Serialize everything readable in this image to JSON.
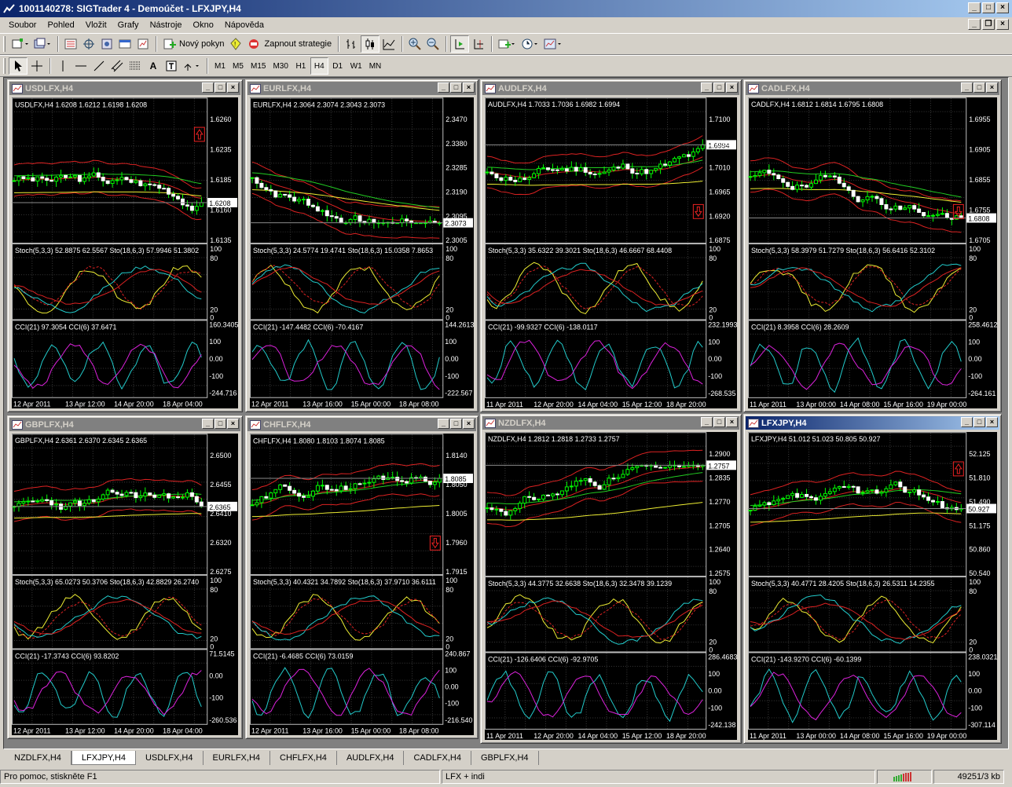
{
  "window": {
    "title": "1001140278: SIGTrader 4 - Demoúčet - LFXJPY,H4"
  },
  "menu": [
    "Soubor",
    "Pohled",
    "Vložit",
    "Grafy",
    "Nástroje",
    "Okno",
    "Nápověda"
  ],
  "toolbar": {
    "new_order": "Nový pokyn",
    "strategies": "Zapnout strategie",
    "timeframes": [
      "M1",
      "M5",
      "M15",
      "M30",
      "H1",
      "H4",
      "D1",
      "W1",
      "MN"
    ],
    "active_timeframe": "H4",
    "text_tool": "A"
  },
  "charts": [
    {
      "title": "USDLFX,H4",
      "ohlc": "USDLFX,H4  1.6208 1.6212 1.6198 1.6208",
      "price_ticks": [
        "1.6260",
        "1.6235",
        "1.6185",
        "1.6160",
        "1.6135"
      ],
      "current": "1.6208",
      "stoch": "Stoch(5,3,3) 52.8875 62.5567   Sto(18,6,3) 57.9946 51.3802",
      "stoch_ticks": [
        "100",
        "80",
        "20",
        "0"
      ],
      "cci": "CCI(21) 97.3054   CCI(6) 37.6471",
      "cci_ticks": [
        "160.3405",
        "100",
        "0.00",
        "-100",
        "-244.716"
      ],
      "dates": [
        "12 Apr 2011",
        "13 Apr 12:00",
        "14 Apr 20:00",
        "18 Apr 04:00"
      ],
      "arrow": "up",
      "seed": 3,
      "trend": -1
    },
    {
      "title": "EURLFX,H4",
      "ohlc": "EURLFX,H4  2.3064 2.3074 2.3043 2.3073",
      "price_ticks": [
        "2.3470",
        "2.3380",
        "2.3285",
        "2.3190",
        "2.3095",
        "2.3005"
      ],
      "current": "2.3073",
      "stoch": "Stoch(5,3,3) 24.5774 19.4741   Sto(18,6,3) 15.0358 7.8653",
      "stoch_ticks": [
        "100",
        "80",
        "20",
        "0"
      ],
      "cci": "CCI(21) -147.4482   CCI(6) -70.4167",
      "cci_ticks": [
        "144.2613",
        "100",
        "0.00",
        "-100",
        "-222.567"
      ],
      "dates": [
        "12 Apr 2011",
        "13 Apr 16:00",
        "15 Apr 00:00",
        "18 Apr 08:00"
      ],
      "arrow": "none",
      "seed": 7,
      "trend": -2
    },
    {
      "title": "AUDLFX,H4",
      "ohlc": "AUDLFX,H4  1.7033 1.7036 1.6982 1.6994",
      "price_ticks": [
        "1.7100",
        "1.7055",
        "1.7010",
        "1.6965",
        "1.6920",
        "1.6875"
      ],
      "current": "1.6994",
      "stoch": "Stoch(5,3,3) 35.6322 39.3021   Sto(18,6,3) 46.6667 68.4408",
      "stoch_ticks": [
        "100",
        "80",
        "20",
        "0"
      ],
      "cci": "CCI(21) -99.9327   CCI(6) -138.0117",
      "cci_ticks": [
        "232.1993",
        "100",
        "0.00",
        "-100",
        "-268.535"
      ],
      "dates": [
        "11 Apr 2011",
        "12 Apr 20:00",
        "14 Apr 04:00",
        "15 Apr 12:00",
        "18 Apr 20:00"
      ],
      "arrow": "down",
      "seed": 11,
      "trend": 0.5
    },
    {
      "title": "CADLFX,H4",
      "ohlc": "CADLFX,H4  1.6812 1.6814 1.6795 1.6808",
      "price_ticks": [
        "1.6955",
        "1.6905",
        "1.6855",
        "1.6755",
        "1.6705"
      ],
      "current": "1.6808",
      "stoch": "Stoch(5,3,3) 58.3979 51.7279   Sto(18,6,3) 56.6416 52.3102",
      "stoch_ticks": [
        "100",
        "80",
        "20",
        "0"
      ],
      "cci": "CCI(21) 8.3958   CCI(6) 28.2609",
      "cci_ticks": [
        "258.4612",
        "100",
        "0.00",
        "-100",
        "-264.161"
      ],
      "dates": [
        "11 Apr 2011",
        "13 Apr 00:00",
        "14 Apr 08:00",
        "15 Apr 16:00",
        "19 Apr 00:00"
      ],
      "arrow": "down",
      "seed": 19,
      "trend": -1
    },
    {
      "title": "GBPLFX,H4",
      "ohlc": "GBPLFX,H4  2.6361 2.6370 2.6345 2.6365",
      "price_ticks": [
        "2.6500",
        "2.6455",
        "2.6410",
        "2.6320",
        "2.6275"
      ],
      "current": "2.6365",
      "stoch": "Stoch(5,3,3) 65.0273 50.3706   Sto(18,6,3) 42.8829 26.2740",
      "stoch_ticks": [
        "100",
        "80",
        "20",
        "0"
      ],
      "cci": "CCI(21) -17.3743   CCI(6) 93.8202",
      "cci_ticks": [
        "71.5145",
        "0.00",
        "-100",
        "-260.536"
      ],
      "dates": [
        "12 Apr 2011",
        "13 Apr 12:00",
        "14 Apr 20:00",
        "18 Apr 04:00"
      ],
      "arrow": "none",
      "seed": 23,
      "trend": -0.5
    },
    {
      "title": "CHFLFX,H4",
      "ohlc": "CHFLFX,H4  1.8080 1.8103 1.8074 1.8085",
      "price_ticks": [
        "1.8140",
        "1.8050",
        "1.8005",
        "1.7960",
        "1.7915"
      ],
      "current": "1.8085",
      "stoch": "Stoch(5,3,3) 40.4321 34.7892   Sto(18,6,3) 37.9710 36.6111",
      "stoch_ticks": [
        "100",
        "80",
        "20",
        "0"
      ],
      "cci": "CCI(21) -6.4685   CCI(6) 73.0159",
      "cci_ticks": [
        "240.867",
        "100",
        "0.00",
        "-100",
        "-216.540"
      ],
      "dates": [
        "12 Apr 2011",
        "13 Apr 16:00",
        "15 Apr 00:00",
        "18 Apr 08:00"
      ],
      "arrow": "down",
      "seed": 29,
      "trend": 1.5
    },
    {
      "title": "NZDLFX,H4",
      "ohlc": "NZDLFX,H4  1.2812 1.2818 1.2733 1.2757",
      "price_ticks": [
        "1.2900",
        "1.2835",
        "1.2770",
        "1.2705",
        "1.2640",
        "1.2575"
      ],
      "current": "1.2757",
      "stoch": "Stoch(5,3,3) 44.3775 32.6638   Sto(18,6,3) 32.3478 39.1239",
      "stoch_ticks": [
        "100",
        "80",
        "20",
        "0"
      ],
      "cci": "CCI(21) -126.6406   CCI(6) -92.9705",
      "cci_ticks": [
        "286.4683",
        "100",
        "0.00",
        "-100",
        "-242.138"
      ],
      "dates": [
        "11 Apr 2011",
        "12 Apr 20:00",
        "14 Apr 04:00",
        "15 Apr 12:00",
        "18 Apr 20:00"
      ],
      "arrow": "none",
      "seed": 31,
      "trend": 2
    },
    {
      "title": "LFXJPY,H4",
      "ohlc": "LFXJPY,H4  51.012 51.023 50.805 50.927",
      "price_ticks": [
        "52.125",
        "51.810",
        "51.490",
        "51.175",
        "50.860",
        "50.540"
      ],
      "current": "50.927",
      "stoch": "Stoch(5,3,3) 40.4771 28.4205   Sto(18,6,3) 26.5311 14.2355",
      "stoch_ticks": [
        "100",
        "80",
        "20",
        "0"
      ],
      "cci": "CCI(21) -143.9270   CCI(6) -60.1399",
      "cci_ticks": [
        "238.0321",
        "100",
        "0.00",
        "-100",
        "-307.114"
      ],
      "dates": [
        "11 Apr 2011",
        "13 Apr 00:00",
        "14 Apr 08:00",
        "15 Apr 16:00",
        "19 Apr 00:00"
      ],
      "arrow": "up",
      "seed": 37,
      "trend": -1.5
    }
  ],
  "tabs": [
    "NZDLFX,H4",
    "LFXJPY,H4",
    "USDLFX,H4",
    "EURLFX,H4",
    "CHFLFX,H4",
    "AUDLFX,H4",
    "CADLFX,H4",
    "GBPLFX,H4"
  ],
  "active_tab": "LFXJPY,H4",
  "status": {
    "help": "Pro pomoc, stiskněte F1",
    "profile": "LFX + indi",
    "traffic": "49251/3 kb"
  }
}
